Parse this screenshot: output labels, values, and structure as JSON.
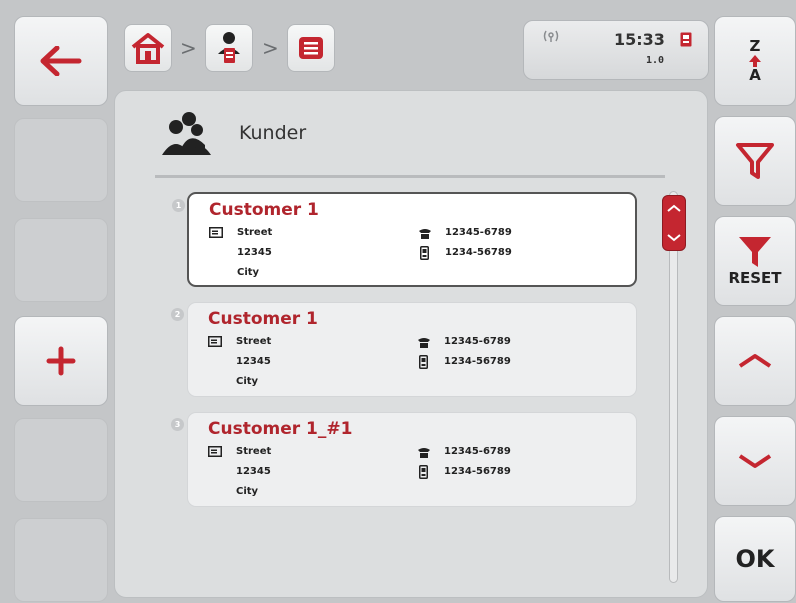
{
  "nav": {
    "separator": ">",
    "home_icon": "home-icon",
    "customer_icon": "customer-icon",
    "list_icon": "list-icon"
  },
  "status": {
    "time": "15:33",
    "version": "1.0",
    "signal_icon": "signal-icon",
    "storage_icon": "memory-card-icon"
  },
  "page": {
    "title": "Kunder",
    "icon": "customers-group-icon"
  },
  "customers": [
    {
      "index": "1",
      "name": "Customer 1",
      "street": "Street",
      "zip": "12345",
      "city": "City",
      "phone": "12345-6789",
      "mobile": "1234-56789"
    },
    {
      "index": "2",
      "name": "Customer 1",
      "street": "Street",
      "zip": "12345",
      "city": "City",
      "phone": "12345-6789",
      "mobile": "1234-56789"
    },
    {
      "index": "3",
      "name": "Customer 1_#1",
      "street": "Street",
      "zip": "12345",
      "city": "City",
      "phone": "12345-6789",
      "mobile": "1234-56789"
    }
  ],
  "right_buttons": {
    "sort_top": "Z",
    "sort_bottom": "A",
    "reset_label": "RESET",
    "ok_label": "OK"
  },
  "colors": {
    "accent": "#b0252d",
    "scroll": "#c42630"
  }
}
